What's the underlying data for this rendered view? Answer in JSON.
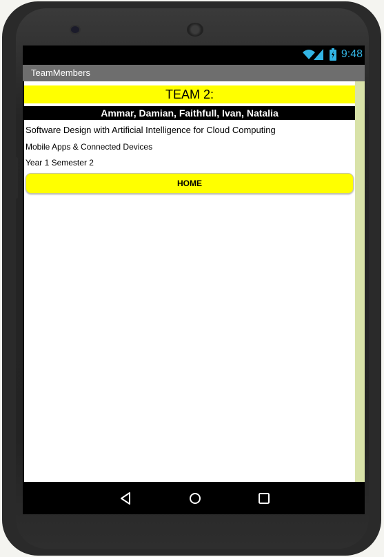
{
  "status_bar": {
    "time": "9:48",
    "icons": [
      "wifi-icon",
      "signal-icon",
      "battery-icon"
    ],
    "icon_color": "#33b5e5"
  },
  "app": {
    "title": "TeamMembers"
  },
  "content": {
    "team_label": "TEAM 2:",
    "members": "Ammar, Damian, Faithfull, Ivan, Natalia",
    "course": "Software Design with Artificial Intelligence for Cloud Computing",
    "module": "Mobile Apps & Connected Devices",
    "term": "Year 1 Semester 2",
    "home_button": "HOME"
  },
  "navigation": {
    "icons": [
      "back-icon",
      "home-icon",
      "recents-icon"
    ]
  },
  "colors": {
    "accent_yellow": "#ffff00",
    "scrollbar": "#d8e2a8",
    "titlebar": "#6e6e6e"
  }
}
